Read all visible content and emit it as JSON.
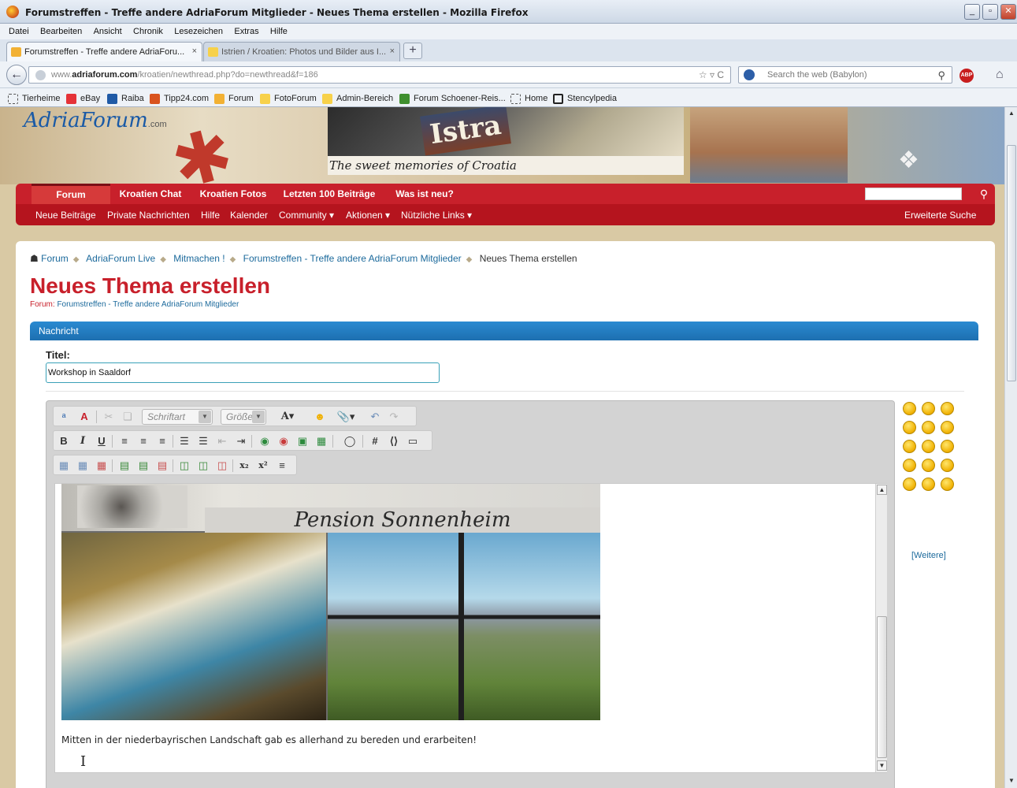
{
  "window": {
    "title": "Forumstreffen - Treffe andere AdriaForum Mitglieder - Neues Thema erstellen - Mozilla Firefox",
    "buttons": [
      "_",
      "▫",
      "✕"
    ]
  },
  "menubar": [
    "Datei",
    "Bearbeiten",
    "Ansicht",
    "Chronik",
    "Lesezeichen",
    "Extras",
    "Hilfe"
  ],
  "tabs": [
    {
      "label": "Forumstreffen - Treffe andere AdriaForu...",
      "close": "×"
    },
    {
      "label": "Istrien / Kroatien: Photos und Bilder aus I...",
      "close": "×"
    }
  ],
  "new_tab": "+",
  "urlbar": {
    "prefix": "www.",
    "domain": "adriaforum.com",
    "path": "/kroatien/newthread.php?do=newthread&f=186",
    "icons": "☆ ▿ C"
  },
  "search": {
    "placeholder": "Search the web (Babylon)"
  },
  "abp": "ABP",
  "bookmarks": [
    {
      "label": "Tierheime",
      "color": "#ffffff"
    },
    {
      "label": "eBay",
      "color": "#e53238"
    },
    {
      "label": "Raiba",
      "color": "#1f5aa6"
    },
    {
      "label": "Tipp24.com",
      "color": "#d9531e"
    },
    {
      "label": "Forum",
      "color": "#f2b134"
    },
    {
      "label": "FotoForum",
      "color": "#f7d14a"
    },
    {
      "label": "Admin-Bereich",
      "color": "#f7d14a"
    },
    {
      "label": "Forum Schoener-Reis...",
      "color": "#3f8f2f"
    },
    {
      "label": "Home",
      "color": "#ffffff"
    },
    {
      "label": "Stencylpedia",
      "color": "#222222"
    }
  ],
  "banner": {
    "logo": "AdriaForum",
    "logo_suffix": ".com",
    "istra": "Istra",
    "tagline": "The sweet memories of Croatia"
  },
  "nav_primary": [
    "Forum",
    "Kroatien Chat",
    "Kroatien Fotos",
    "Letzten 100 Beiträge",
    "Was ist neu?"
  ],
  "nav_secondary": [
    "Neue Beiträge",
    "Private Nachrichten",
    "Hilfe",
    "Kalender",
    "Community ▾",
    "Aktionen ▾",
    "Nützliche Links ▾"
  ],
  "advanced_search": "Erweiterte Suche",
  "breadcrumb": [
    "Forum",
    "AdriaForum Live",
    "Mitmachen !",
    "Forumstreffen - Treffe andere AdriaForum Mitglieder",
    "Neues Thema erstellen"
  ],
  "page_title": "Neues Thema erstellen",
  "forum_line": {
    "prefix": "Forum:",
    "name": "Forumstreffen - Treffe andere AdriaForum Mitglieder"
  },
  "section_header": "Nachricht",
  "title_field": {
    "label": "Titel:",
    "value": "Workshop in Saaldorf"
  },
  "toolbar": {
    "font_label": "Schriftart",
    "size_label": "Größe"
  },
  "editor": {
    "image_caption": "Pension Sonnenheim",
    "text": "Mitten in der niederbayrischen Landschaft gab es allerhand zu bereden und erarbeiten!"
  },
  "smilies_more": "[Weitere]"
}
